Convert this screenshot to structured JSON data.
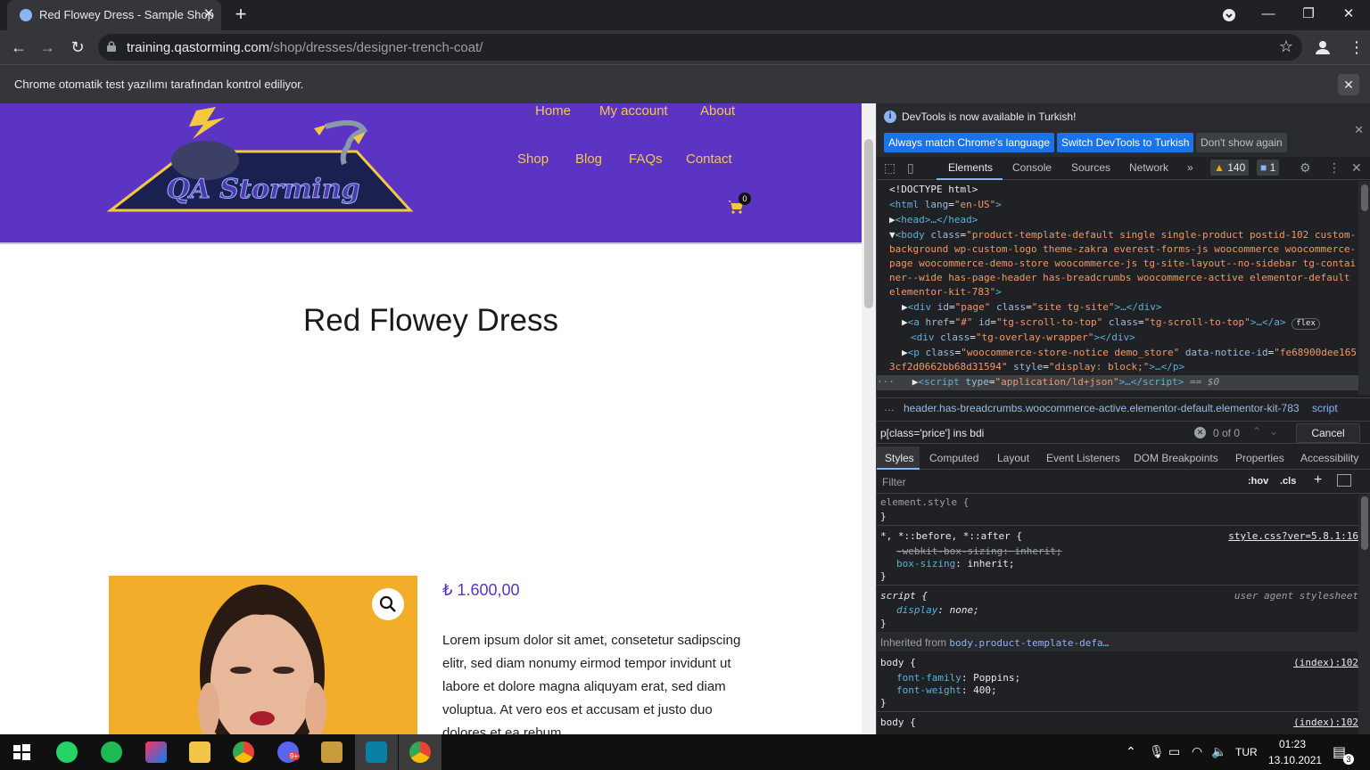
{
  "browser": {
    "tab_title": "Red Flowey Dress - Sample Shop",
    "url_host": "training.qastorming.com",
    "url_path": "/shop/dresses/designer-trench-coat/",
    "infobar_message": "Chrome otomatik test yazılımı tarafından kontrol ediliyor."
  },
  "site": {
    "nav_top": [
      "Home",
      "My account",
      "About"
    ],
    "nav_bottom": [
      "Shop",
      "Blog",
      "FAQs",
      "Contact"
    ],
    "cart_count": "0",
    "logo_text": "QA Storming"
  },
  "product": {
    "title": "Red Flowey Dress",
    "price": "₺ 1.600,00",
    "description": "Lorem ipsum dolor sit amet, consetetur sadipscing elitr, sed diam nonumy eirmod tempor invidunt ut labore et dolore magna aliquyam erat, sed diam voluptua. At vero eos et accusam et justo duo dolores et ea rebum."
  },
  "devtools": {
    "banner_text": "DevTools is now available in Turkish!",
    "banner_btn_match": "Always match Chrome's language",
    "banner_btn_switch": "Switch DevTools to Turkish",
    "banner_btn_dismiss": "Don't show again",
    "tabs": [
      "Elements",
      "Console",
      "Sources",
      "Network"
    ],
    "more_tabs": "»",
    "warnings_count": "140",
    "issues_count": "1",
    "dom": {
      "doctype": "<!DOCTYPE html>",
      "html_open": "<html",
      "html_lang_attr": "lang",
      "html_lang_val": "\"en-US\"",
      "head": "<head>…</head>",
      "body_tag": "<body",
      "body_class_attr": "class",
      "body_class_1": "\"product-template-default single single-product postid-102 custom-",
      "body_class_2": "background wp-custom-logo theme-zakra everest-forms-js woocommerce woocommerce-",
      "body_class_3": "page woocommerce-demo-store woocommerce-js tg-site-layout--no-sidebar tg-contai",
      "body_class_4": "ner--wide has-page-header has-breadcrumbs woocommerce-active elementor-default",
      "body_class_5": "elementor-kit-783\"",
      "div_page": "<div",
      "div_page_attrs_id": "id",
      "div_page_id_val": "\"page\"",
      "div_page_class_val": "\"site tg-site\"",
      "a_scroll_href_val": "\"#\"",
      "a_scroll_id_val": "\"tg-scroll-to-top\"",
      "a_scroll_class_val": "\"tg-scroll-to-top\"",
      "flex_badge": "flex",
      "overlay_class_val": "\"tg-overlay-wrapper\"",
      "p_class_val": "\"woocommerce-store-notice demo_store\"",
      "p_notice_attr": "data-notice-id",
      "p_notice_val_1": "\"fe68900dee165",
      "p_notice_val_2": "3cf2d0662bb68d31594\"",
      "p_style_val": "\"display: block;\"",
      "script_type_val": "\"application/ld+json\"",
      "selected_marker": "== $0"
    },
    "breadcrumb": "header.has-breadcrumbs.woocommerce-active.elementor-default.elementor-kit-783",
    "breadcrumb_last": "script",
    "search_value": "p[class='price'] ins bdi",
    "search_count": "0 of 0",
    "search_cancel": "Cancel",
    "style_tabs": [
      "Styles",
      "Computed",
      "Layout",
      "Event Listeners",
      "DOM Breakpoints",
      "Properties",
      "Accessibility"
    ],
    "filter_placeholder": "Filter",
    "hov": ":hov",
    "cls": ".cls",
    "styles": {
      "element_style": "element.style {",
      "close_brace": "}",
      "universal_selector": "*, *::before, *::after {",
      "universal_source": "style.css?ver=5.8.1:16",
      "webkit_prop": "-webkit-box-sizing",
      "webkit_val": "inherit;",
      "box_prop": "box-sizing",
      "box_val": "inherit;",
      "script_selector": "script {",
      "ua_source": "user agent stylesheet",
      "display_prop": "display",
      "display_val": "none;",
      "inherited_label": "Inherited from",
      "inherited_from": "body.product-template-defa…",
      "body_selector": "body {",
      "index_source": "(index):102",
      "ff_prop": "font-family",
      "ff_val": "Poppins;",
      "fw_prop": "font-weight",
      "fw_val": "400;"
    }
  },
  "taskbar": {
    "language": "TUR",
    "time": "01:23",
    "date": "13.10.2021",
    "notification_count": "3",
    "discord_badge": "9+"
  }
}
